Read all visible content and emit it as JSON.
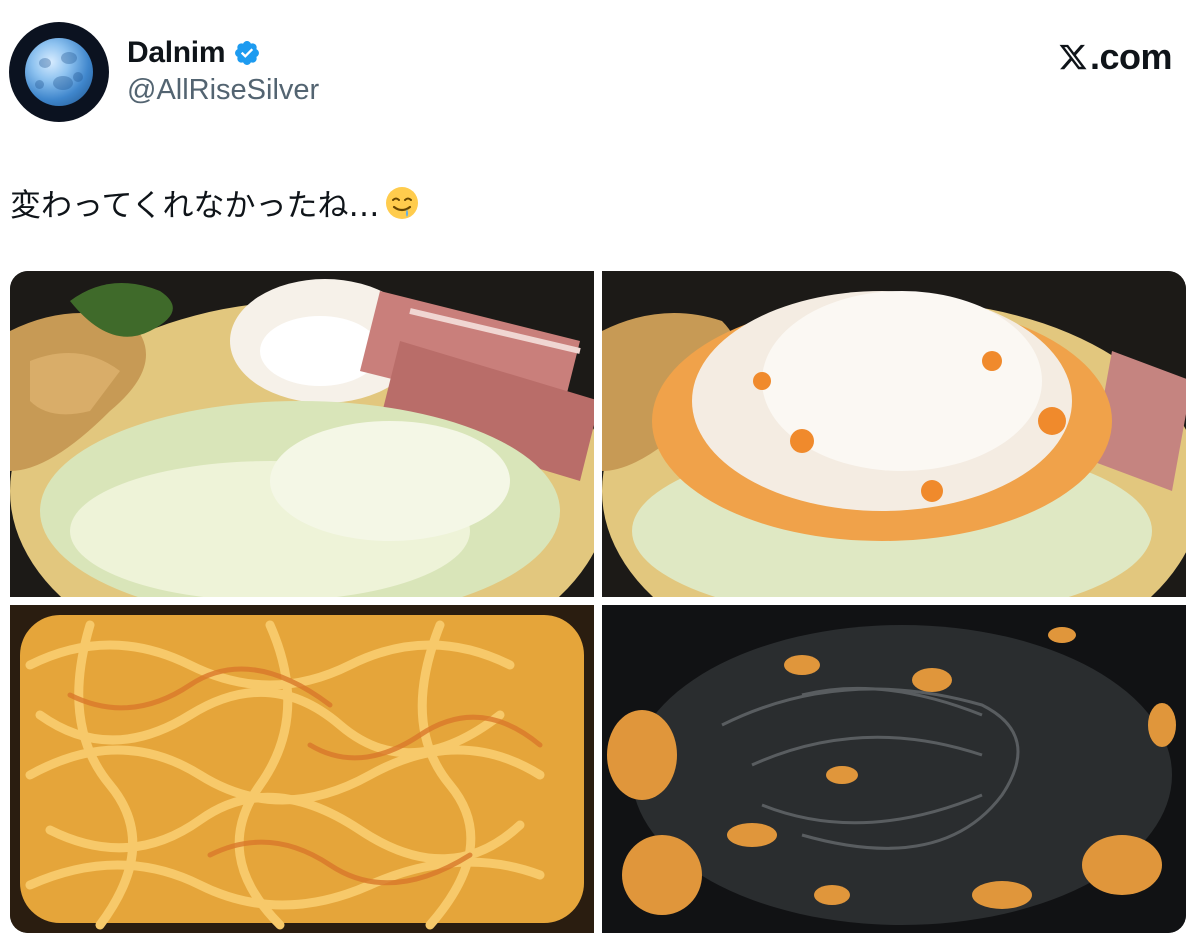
{
  "author": {
    "display_name": "Dalnim",
    "handle": "@AllRiseSilver",
    "verified": true,
    "avatar_icon": "moon-avatar"
  },
  "brand": {
    "label": ".com",
    "icon": "x-logo-icon"
  },
  "tweet": {
    "text": "変わってくれなかったね…",
    "emoji": "drooling-face-emoji"
  },
  "media": {
    "count": 4,
    "items": [
      {
        "subject": "ramen-toppings-photo"
      },
      {
        "subject": "grated-radish-topping-photo"
      },
      {
        "subject": "mixed-noodles-photo"
      },
      {
        "subject": "empty-bowl-photo"
      }
    ]
  },
  "colors": {
    "verified_blue": "#1d9bf0",
    "text_primary": "#0f1419",
    "text_secondary": "#536471"
  }
}
